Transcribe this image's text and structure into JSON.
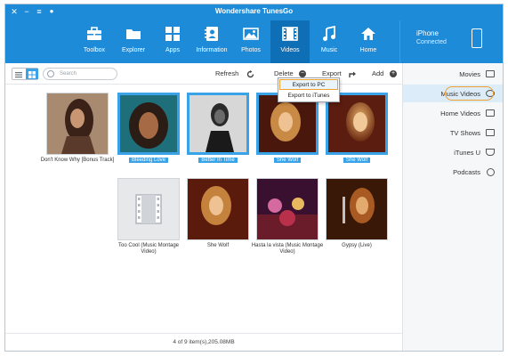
{
  "app": {
    "title": "Wondershare TunesGo"
  },
  "device": {
    "name": "iPhone",
    "status": "Connected"
  },
  "toolbar": {
    "items": [
      {
        "label": "Home",
        "icon": "home-icon"
      },
      {
        "label": "Music",
        "icon": "music-note-icon"
      },
      {
        "label": "Videos",
        "icon": "film-icon"
      },
      {
        "label": "Photos",
        "icon": "photo-icon"
      },
      {
        "label": "Information",
        "icon": "contacts-icon"
      },
      {
        "label": "Apps",
        "icon": "apps-grid-icon"
      },
      {
        "label": "Explorer",
        "icon": "folder-icon"
      },
      {
        "label": "Toolbox",
        "icon": "toolbox-icon"
      }
    ]
  },
  "actions": {
    "add": "Add",
    "export": "Export",
    "delete": "Delete",
    "refresh": "Refresh",
    "search_placeholder": "Search"
  },
  "export_menu": {
    "items": [
      "Export to PC",
      "Export to iTunes"
    ]
  },
  "videos": [
    {
      "title": "She Wolf",
      "selected": true
    },
    {
      "title": "She Wolf",
      "selected": true
    },
    {
      "title": "Better In Time",
      "selected": true
    },
    {
      "title": "Bleeding Love",
      "selected": true
    },
    {
      "title": "Don't Know Why [Bonus Track]",
      "selected": false
    },
    {
      "title": "Gypsy (Live)",
      "selected": false
    },
    {
      "title": "Hasta la vista (Music Montage Video)",
      "selected": false
    },
    {
      "title": "She Wolf",
      "selected": false
    },
    {
      "title": "Too Cool (Music Montage Video)",
      "selected": false
    }
  ],
  "status": {
    "text": "4 of 9 item(s),205.08MB"
  },
  "sidebar": {
    "items": [
      {
        "label": "Movies",
        "icon": "movie-icon"
      },
      {
        "label": "Music Videos",
        "icon": "music-video-icon"
      },
      {
        "label": "Home Videos",
        "icon": "home-video-icon"
      },
      {
        "label": "TV Shows",
        "icon": "tv-icon"
      },
      {
        "label": "iTunes U",
        "icon": "itunes-u-icon"
      },
      {
        "label": "Podcasts",
        "icon": "podcast-icon"
      }
    ]
  },
  "colors": {
    "primary": "#1d8bd8",
    "toolbar_active": "#0f6fb6",
    "selection": "#3aa3e8",
    "highlight_ring": "#f0a030"
  }
}
